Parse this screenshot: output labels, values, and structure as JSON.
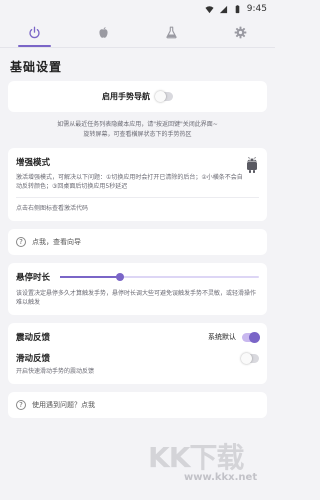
{
  "status_bar": {
    "time": "9:45"
  },
  "tabs": [
    {
      "icon": "power-icon",
      "active": true
    },
    {
      "icon": "apple-icon",
      "active": false
    },
    {
      "icon": "flask-icon",
      "active": false
    },
    {
      "icon": "gear-icon",
      "active": false
    }
  ],
  "page_title": "基础设置",
  "gesture_nav": {
    "label": "启用手势导航",
    "enabled": false,
    "note_line1": "如需从最近任务列表隐藏本应用，请\"按返回键\"关闭此界面~",
    "note_line2": "旋转屏幕，可查看横屏状态下的手势热区"
  },
  "enhanced_mode": {
    "title": "增强模式",
    "description": "激活增强模式，可解决以下问题：①切换应用时会打开已清除的后台；②小横条不会自动反转颜色；③回桌面后切换应用5秒延迟",
    "footer": "点击右侧图标查看激活代码",
    "icon": "android-icon"
  },
  "guide_link": {
    "label": "点我，查看向导"
  },
  "hover_duration": {
    "title": "悬停时长",
    "value_fraction": 0.3,
    "description": "该设置决定悬停多久才算触发手势，悬停时长调大些可避免误触发手势不灵敏，或轻滑操作难以触发"
  },
  "vibration": {
    "title": "震动反馈",
    "mode_label": "系统默认",
    "enabled": true
  },
  "slide_feedback": {
    "title": "滑动反馈",
    "description": "开启快速滑动手势的震动反馈",
    "enabled": false
  },
  "problem_link": {
    "label": "使用遇到问题？点我"
  },
  "watermark": {
    "logo": "KK下载",
    "url": "www.kkx.net"
  },
  "colors": {
    "accent": "#7a65c7",
    "background": "#f3f3f6"
  }
}
